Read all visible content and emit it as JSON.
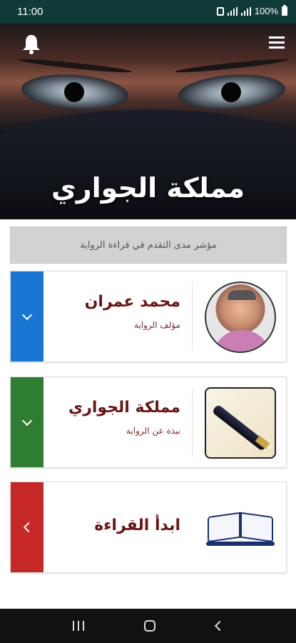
{
  "status_bar": {
    "time": "11:00",
    "battery": "100%"
  },
  "header": {
    "title": "مملكة الجواري"
  },
  "progress": {
    "label": "مؤشر مدى التقدم في قراءة الرواية"
  },
  "cards": [
    {
      "title": "محمد عمران",
      "subtitle": "مؤلف الرواية",
      "accent": "#1976d2",
      "icon": "chevron-down-icon"
    },
    {
      "title": "مملكة الجواري",
      "subtitle": "نبذة عن الرواية",
      "accent": "#2e7d32",
      "icon": "chevron-down-icon"
    },
    {
      "title": "ابدأ القراءة",
      "subtitle": "",
      "accent": "#c62828",
      "icon": "chevron-left-icon"
    }
  ]
}
